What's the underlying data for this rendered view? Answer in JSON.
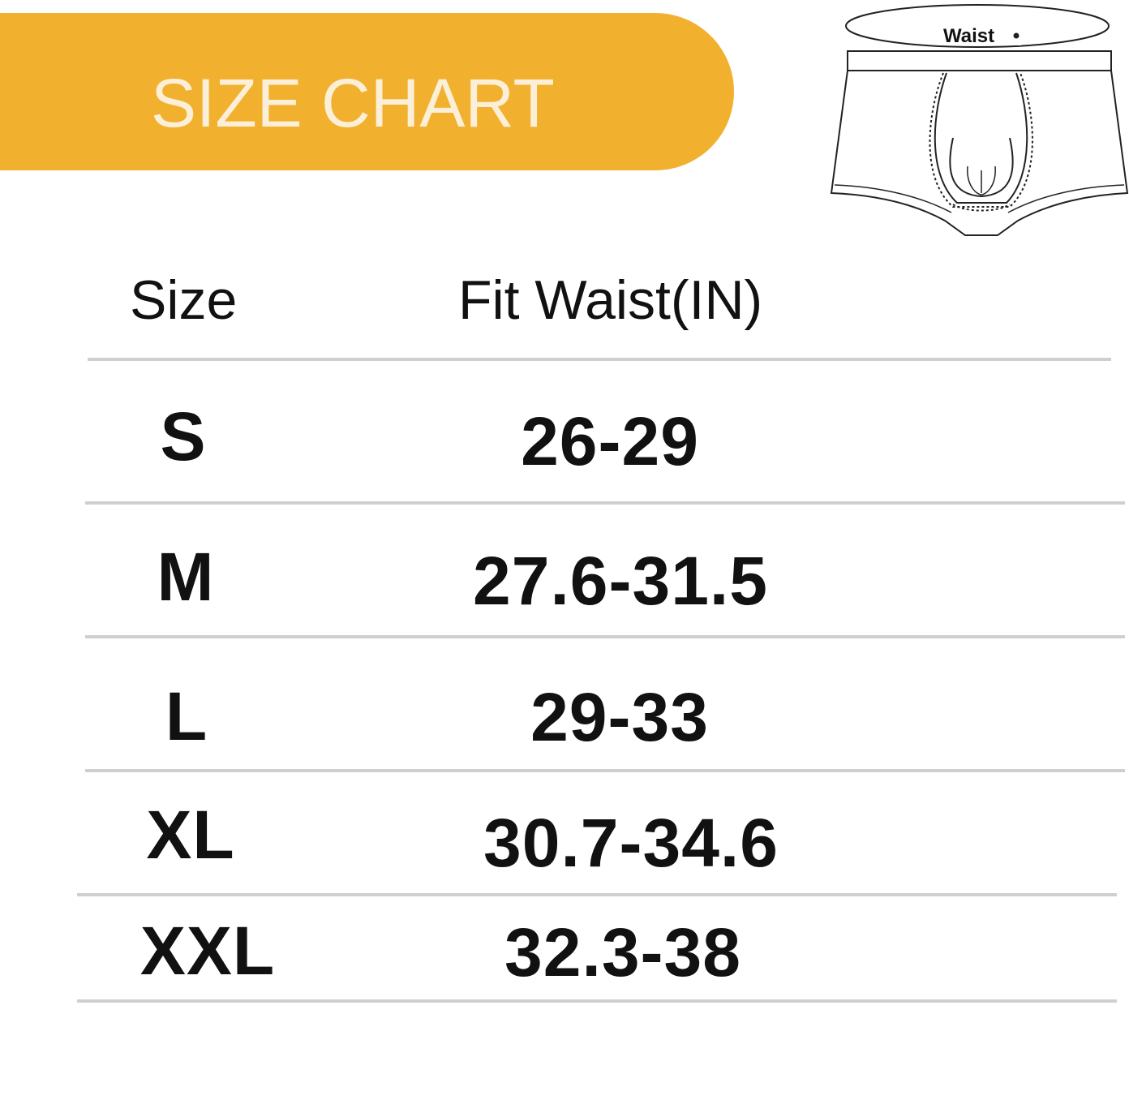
{
  "banner": {
    "title": "SIZE CHART",
    "color": "#F2B02F",
    "text_color": "#FCEFD8"
  },
  "diagram": {
    "label": "Waist",
    "icon": "boxer-brief-waist-diagram"
  },
  "table": {
    "headers": {
      "size": "Size",
      "waist": "Fit Waist(IN)"
    },
    "rows": [
      {
        "size": "S",
        "waist": "26-29"
      },
      {
        "size": "M",
        "waist": "27.6-31.5"
      },
      {
        "size": "L",
        "waist": "29-33"
      },
      {
        "size": "XL",
        "waist": "30.7-34.6"
      },
      {
        "size": "XXL",
        "waist": "32.3-38"
      }
    ],
    "rule_color": "#CFCFCF"
  }
}
